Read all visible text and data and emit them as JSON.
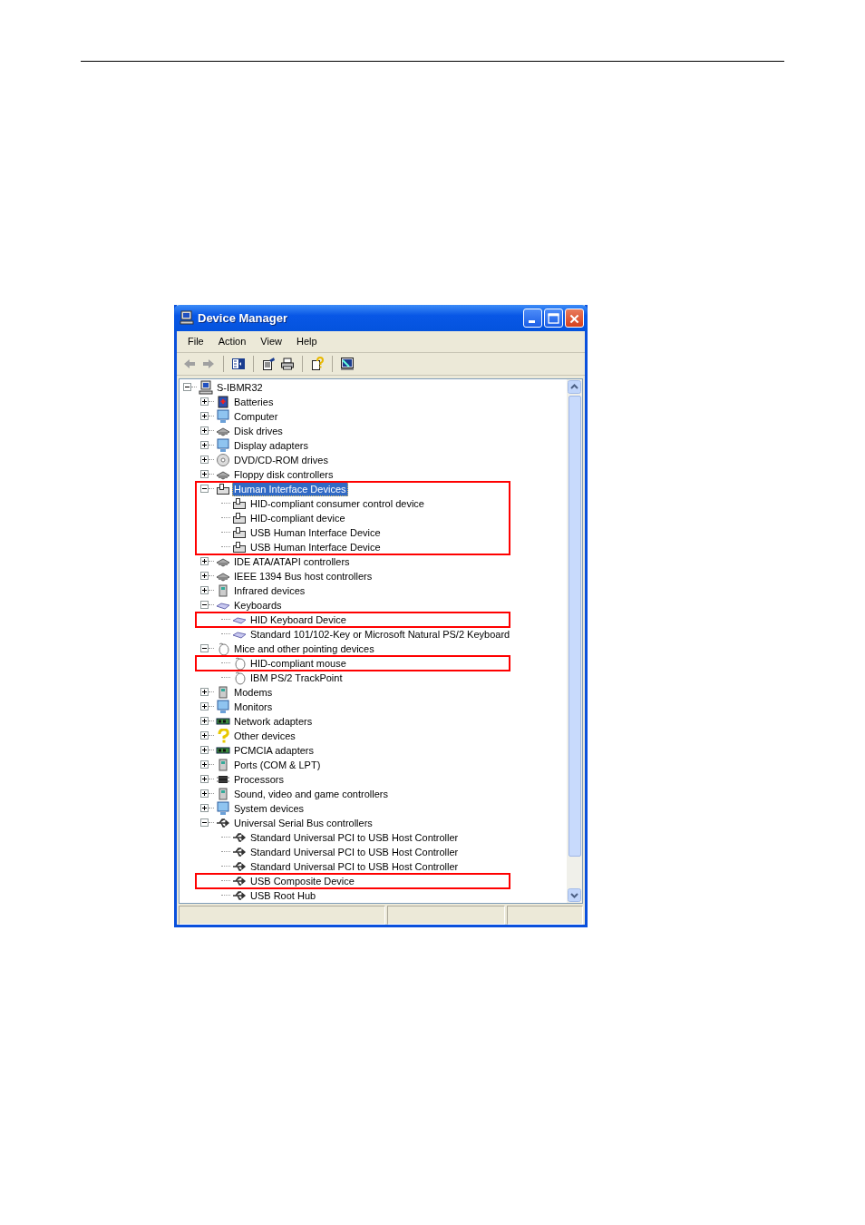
{
  "window": {
    "title": "Device Manager"
  },
  "menu": [
    "File",
    "Action",
    "View",
    "Help"
  ],
  "tree": {
    "label": "S-IBMR32",
    "expanded": true,
    "selected": false,
    "children": [
      {
        "label": "Batteries",
        "expanded": false,
        "selected": false,
        "outlined": false
      },
      {
        "label": "Computer",
        "expanded": false,
        "selected": false,
        "outlined": false
      },
      {
        "label": "Disk drives",
        "expanded": false,
        "selected": false,
        "outlined": false
      },
      {
        "label": "Display adapters",
        "expanded": false,
        "selected": false,
        "outlined": false
      },
      {
        "label": "DVD/CD-ROM drives",
        "expanded": false,
        "selected": false,
        "outlined": false
      },
      {
        "label": "Floppy disk controllers",
        "expanded": false,
        "selected": false,
        "outlined": false
      },
      {
        "label": "Human Interface Devices",
        "expanded": true,
        "selected": true,
        "outlined": true,
        "children": [
          {
            "label": "HID-compliant consumer control device",
            "selected": false,
            "outlined": false
          },
          {
            "label": "HID-compliant device",
            "selected": false,
            "outlined": false
          },
          {
            "label": "USB Human Interface Device",
            "selected": false,
            "outlined": false
          },
          {
            "label": "USB Human Interface Device",
            "selected": false,
            "outlined": false
          }
        ]
      },
      {
        "label": "IDE ATA/ATAPI controllers",
        "expanded": false,
        "selected": false,
        "outlined": false
      },
      {
        "label": "IEEE 1394 Bus host controllers",
        "expanded": false,
        "selected": false,
        "outlined": false
      },
      {
        "label": "Infrared devices",
        "expanded": false,
        "selected": false,
        "outlined": false
      },
      {
        "label": "Keyboards",
        "expanded": true,
        "selected": false,
        "outlined": false,
        "children": [
          {
            "label": "HID Keyboard Device",
            "selected": false,
            "outlined": true
          },
          {
            "label": "Standard 101/102-Key or Microsoft Natural PS/2 Keyboard",
            "selected": false,
            "outlined": false
          }
        ]
      },
      {
        "label": "Mice and other pointing devices",
        "expanded": true,
        "selected": false,
        "outlined": false,
        "children": [
          {
            "label": "HID-compliant mouse",
            "selected": false,
            "outlined": true
          },
          {
            "label": "IBM PS/2 TrackPoint",
            "selected": false,
            "outlined": false
          }
        ]
      },
      {
        "label": "Modems",
        "expanded": false,
        "selected": false,
        "outlined": false
      },
      {
        "label": "Monitors",
        "expanded": false,
        "selected": false,
        "outlined": false
      },
      {
        "label": "Network adapters",
        "expanded": false,
        "selected": false,
        "outlined": false
      },
      {
        "label": "Other devices",
        "expanded": false,
        "selected": false,
        "outlined": false
      },
      {
        "label": "PCMCIA adapters",
        "expanded": false,
        "selected": false,
        "outlined": false
      },
      {
        "label": "Ports (COM & LPT)",
        "expanded": false,
        "selected": false,
        "outlined": false
      },
      {
        "label": "Processors",
        "expanded": false,
        "selected": false,
        "outlined": false
      },
      {
        "label": "Sound, video and game controllers",
        "expanded": false,
        "selected": false,
        "outlined": false
      },
      {
        "label": "System devices",
        "expanded": false,
        "selected": false,
        "outlined": false
      },
      {
        "label": "Universal Serial Bus controllers",
        "expanded": true,
        "selected": false,
        "outlined": false,
        "children": [
          {
            "label": "Standard Universal PCI to USB Host Controller",
            "selected": false,
            "outlined": false
          },
          {
            "label": "Standard Universal PCI to USB Host Controller",
            "selected": false,
            "outlined": false
          },
          {
            "label": "Standard Universal PCI to USB Host Controller",
            "selected": false,
            "outlined": false
          },
          {
            "label": "USB Composite Device",
            "selected": false,
            "outlined": true
          },
          {
            "label": "USB Root Hub",
            "selected": false,
            "outlined": false
          }
        ]
      }
    ]
  }
}
